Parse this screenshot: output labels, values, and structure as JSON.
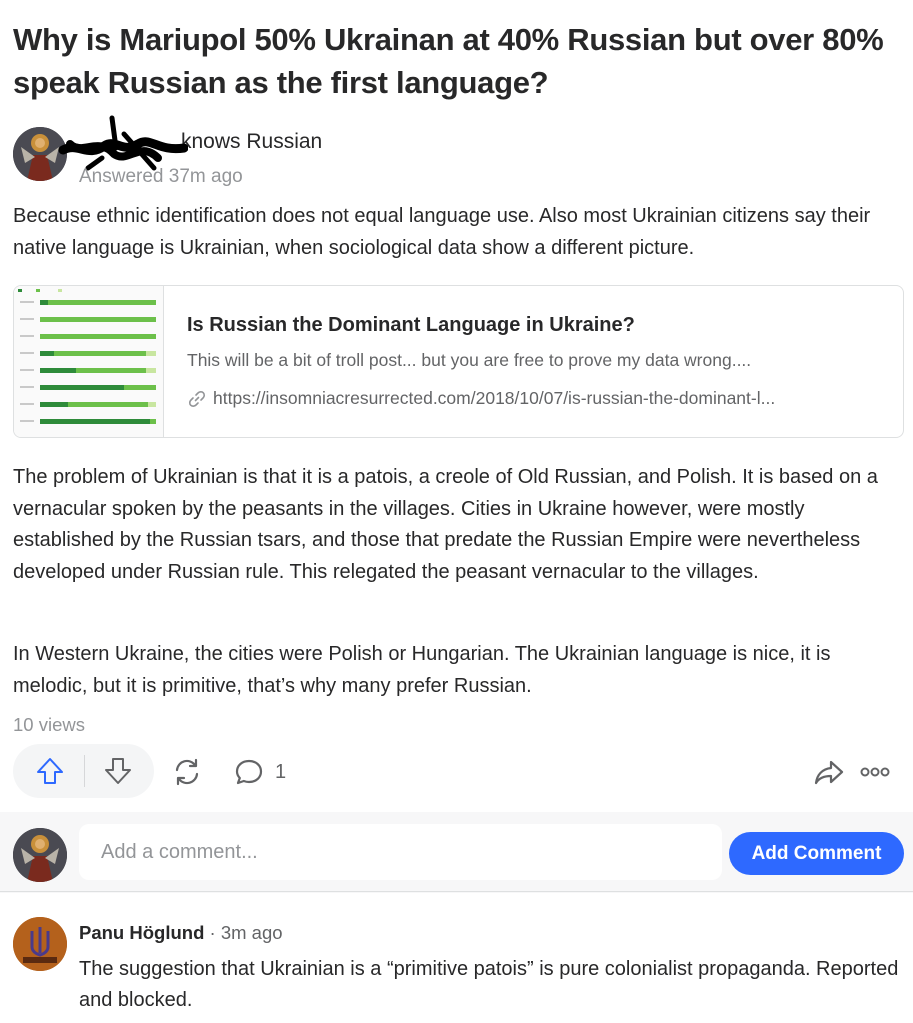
{
  "question": {
    "title": "Why is Mariupol 50% Ukrainan at 40% Russian but over 80% speak Russian as the first language?"
  },
  "answer": {
    "author_credential": "knows Russian",
    "answered_time": "Answered 37m ago",
    "paragraphs": [
      "Because ethnic identification does not equal language use. Also most Ukrainian citizens say their native language is Ukrainian, when sociological data show a different picture.",
      "The problem of Ukrainian is that it is a patois, a creole of Old Russian, and Polish. It is based on a vernacular spoken by the peasants in the villages. Cities in Ukraine however, were mostly established by the Russian tsars, and those that predate the Russian Empire were nevertheless developed under Russian rule. This relegated the peasant vernacular to the villages.",
      "In Western Ukraine, the cities were Polish or Hungarian. The Ukrainian language is nice, it is melodic, but it is primitive, that’s why many prefer Russian."
    ],
    "link_card": {
      "title": "Is Russian the Dominant Language in Ukraine?",
      "description": "This will be a bit of troll post... but you are free to prove my data wrong....",
      "url": "https://insomniacresurrected.com/2018/10/07/is-russian-the-dominant-l..."
    },
    "views": "10 views",
    "comment_count": "1"
  },
  "comment_box": {
    "placeholder": "Add a comment...",
    "button_label": "Add Comment"
  },
  "comments": [
    {
      "author": "Panu Höglund",
      "time": "· 3m ago",
      "text": "The suggestion that Ukrainian is a “primitive patois” is pure colonialist propaganda. Reported and blocked."
    }
  ],
  "colors": {
    "primary_blue": "#2e69ff",
    "text_dark": "#282829",
    "text_muted": "#939598",
    "bar_green": "#6cc04a"
  },
  "icons": [
    "upvote-icon",
    "downvote-icon",
    "share-icon",
    "comment-icon",
    "forward-icon",
    "more-icon",
    "link-icon"
  ]
}
